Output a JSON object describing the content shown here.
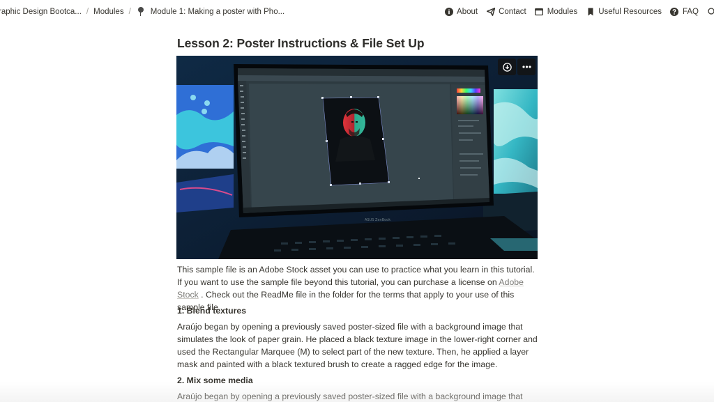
{
  "breadcrumb": {
    "items": [
      {
        "label": "raphic Design Bootca..."
      },
      {
        "label": "Modules"
      },
      {
        "label": "Module 1: Making a poster with Pho...",
        "icon": "pushpin-icon"
      }
    ],
    "separator": "/"
  },
  "nav": {
    "items": [
      {
        "label": "About",
        "icon": "info-circle-icon"
      },
      {
        "label": "Contact",
        "icon": "paper-plane-icon"
      },
      {
        "label": "Modules",
        "icon": "browser-window-icon"
      },
      {
        "label": "Useful Resources",
        "icon": "bookmark-icon"
      },
      {
        "label": "FAQ",
        "icon": "question-circle-icon"
      }
    ]
  },
  "page": {
    "title": "Lesson 2: Poster Instructions & File Set Up"
  },
  "media": {
    "description": "Laptop displaying Photoshop with a red/teal split-lit portrait",
    "laptop_brand_text": "ASUS ZenBook",
    "download_icon": "download-icon",
    "more_icon": "more-horizontal-icon",
    "colors": {
      "background": "#0d151c",
      "screen": "#2b3a40",
      "accent_teal": "#3fc1c9",
      "accent_blue": "#2a6fc9",
      "portrait_red": "#e0343a",
      "portrait_teal": "#35b89a"
    }
  },
  "content": {
    "intro_before_link": "This sample file is an Adobe Stock asset you can use to practice what you learn in this tutorial. If you want to use the sample file beyond this tutorial, you can purchase a license on ",
    "intro_link": "Adobe Stock",
    "intro_after_link": " . Check out the ReadMe file in the folder for the terms that apply to your use of this sample file.",
    "section1_heading": "1. Blend textures",
    "section1_body": "Araújo began by opening a previously saved poster-sized file with a background image that simulates the look of paper grain. He placed a black texture image in the lower-right corner and used the Rectangular Marquee (M) to select part of the new texture. Then, he applied a layer mask and painted with a black textured brush to create a ragged edge for the image.",
    "section2_heading": "2. Mix some media",
    "section2_body": "Araújo began by opening a previously saved poster-sized file with a background image that"
  }
}
